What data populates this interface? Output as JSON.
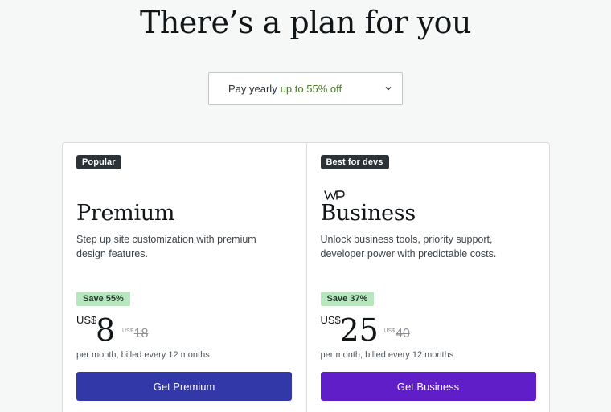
{
  "hero": {
    "title": "There’s a plan for you"
  },
  "billing": {
    "label": "Pay yearly",
    "discount": "up to 55% off"
  },
  "plans": [
    {
      "badge": "Popular",
      "name": "Premium",
      "description": "Step up site customization with premium design features.",
      "save": "Save 55%",
      "currency": "US$",
      "price": "8",
      "original_currency": "US$",
      "original_price": "18",
      "billing_note": "per month, billed every 12 months",
      "cta": "Get Premium",
      "cta_color": "#3338a8"
    },
    {
      "badge": "Best for devs",
      "logo_icon": "wp-logo-icon",
      "name": "Business",
      "description": "Unlock business tools, priority support, developer power with predictable costs.",
      "save": "Save 37%",
      "currency": "US$",
      "price": "25",
      "original_currency": "US$",
      "original_price": "40",
      "billing_note": "per month, billed every 12 months",
      "cta": "Get Business",
      "cta_color": "#5f1ec7"
    }
  ],
  "colors": {
    "save_tag_bg": "#b8e6bf",
    "badge_bg": "#2c3338",
    "discount_text": "#4a7a2c"
  }
}
